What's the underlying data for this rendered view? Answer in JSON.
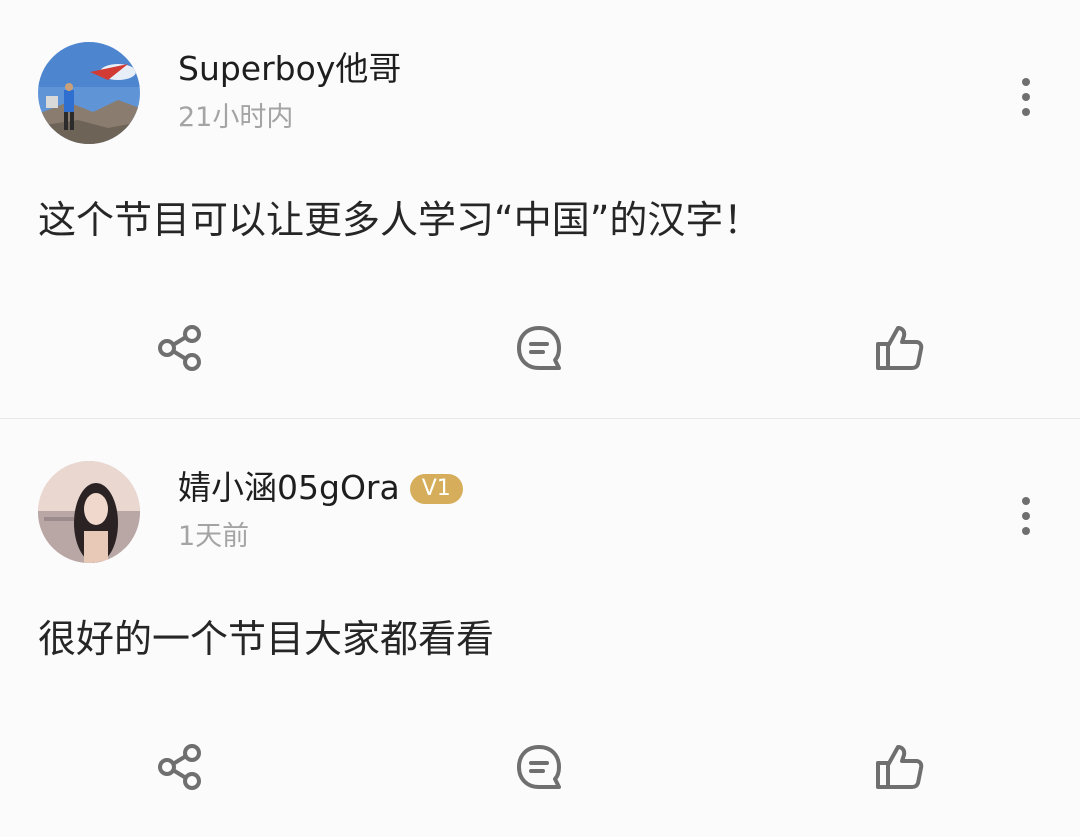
{
  "posts": [
    {
      "username": "Superboy他哥",
      "time": "21小时内",
      "content": "这个节目可以让更多人学习“中国”的汉字！",
      "icons": {
        "share": "share-icon",
        "comment": "comment-icon",
        "like": "thumbs-up-icon",
        "more": "more-vertical-icon"
      }
    },
    {
      "username": "婧小涵05gOra",
      "badge": "V1",
      "time": "1天前",
      "content": "很好的一个节目大家都看看",
      "icons": {
        "share": "share-icon",
        "comment": "comment-icon",
        "like": "thumbs-up-icon",
        "more": "more-vertical-icon"
      }
    }
  ],
  "colors": {
    "background": "#fcfbfc",
    "username": "#1e1e1e",
    "timestamp": "#a4a4a4",
    "icon": "#6f6f6f",
    "badge": "#d6ae5b"
  }
}
